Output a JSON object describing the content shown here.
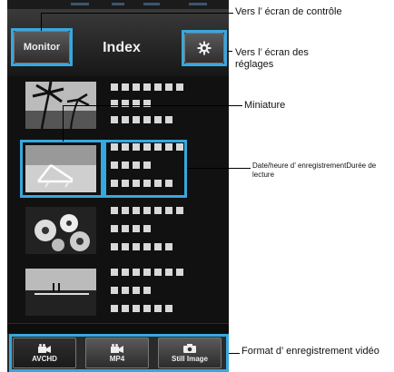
{
  "app": {
    "title": "Index",
    "monitor_label": "Monitor",
    "settings_icon": "gear-icon"
  },
  "thumbnail_count": 4,
  "formats": [
    "AVCHD",
    "MP4",
    "Still Image"
  ],
  "format_icons": [
    "video-camera-icon",
    "video-camera-icon",
    "camera-icon"
  ],
  "annotations": {
    "to_monitor": "Vers l’ écran de contrôle",
    "to_settings": "Vers l’ écran des réglages",
    "thumbnail": "Miniature",
    "date_time": "Date/heure d’ enregistrementDurée de lecture",
    "video_format": "Format d’ enregistrement vidéo"
  },
  "colors": {
    "highlight": "#37a8de",
    "background": "#0d0d0d"
  }
}
